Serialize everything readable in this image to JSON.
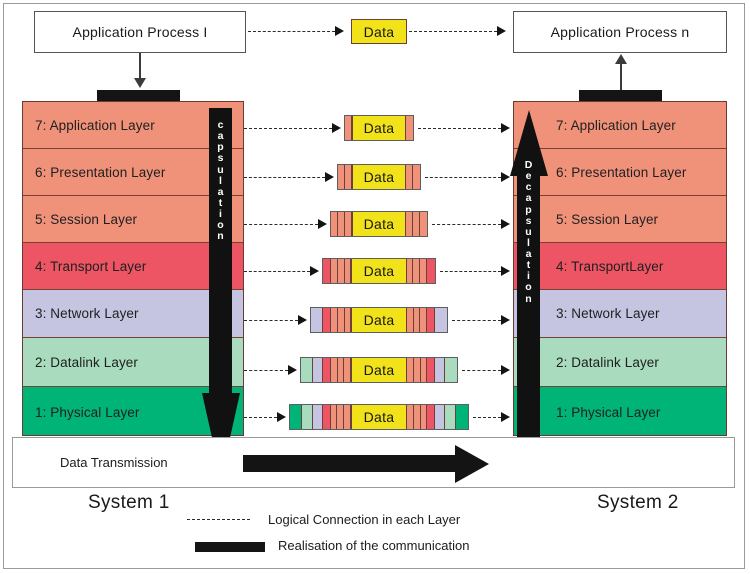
{
  "diagram": {
    "title": "OSI Layer Encapsulation and Decapsulation",
    "data_label": "Data"
  },
  "top": {
    "process_left": "Application Process I",
    "process_right": "Application Process n",
    "top_packet_label": "Data"
  },
  "systems": {
    "left_name": "System 1",
    "right_name": "System 2"
  },
  "layers_left": [
    {
      "label": "7: Application Layer",
      "color": "#f0927a"
    },
    {
      "label": "6: Presentation Layer",
      "color": "#f0927a"
    },
    {
      "label": "5: Session Layer",
      "color": "#f0927a"
    },
    {
      "label": "4: Transport  Layer",
      "color": "#ed5464"
    },
    {
      "label": "3: Network Layer",
      "color": "#c5c5e2"
    },
    {
      "label": "2: Datalink Layer",
      "color": "#a9dcbe"
    },
    {
      "label": "1: Physical Layer",
      "color": "#00b477"
    }
  ],
  "layers_right": [
    {
      "label": "7: Application Layer",
      "color": "#f0927a"
    },
    {
      "label": "6: Presentation Layer",
      "color": "#f0927a"
    },
    {
      "label": "5: Session Layer",
      "color": "#f0927a"
    },
    {
      "label": "4: TransportLayer",
      "color": "#ed5464"
    },
    {
      "label": "3: Network Layer",
      "color": "#c5c5e2"
    },
    {
      "label": "2: Datalink Layer",
      "color": "#a9dcbe"
    },
    {
      "label": "1: Physical Layer",
      "color": "#00b477"
    }
  ],
  "encapsulation": {
    "left_word": "capsulation",
    "left_letters": [
      "c",
      "a",
      "p",
      "s",
      "u",
      "l",
      "a",
      "t",
      "i",
      "o",
      "n"
    ],
    "right_word": "Decapsulation",
    "right_letters": [
      "D",
      "e",
      "c",
      "a",
      "p",
      "s",
      "u",
      "l",
      "a",
      "t",
      "i",
      "o",
      "n"
    ]
  },
  "packets": [
    {
      "layer": "7",
      "label": "Data",
      "left": [
        {
          "c": "#f0927a",
          "w": 7
        }
      ],
      "right": [
        {
          "c": "#f0927a",
          "w": 7
        }
      ]
    },
    {
      "layer": "6",
      "label": "Data",
      "left": [
        {
          "c": "#f0927a",
          "w": 7
        },
        {
          "c": "#f0927a",
          "w": 7
        }
      ],
      "right": [
        {
          "c": "#f0927a",
          "w": 7
        },
        {
          "c": "#f0927a",
          "w": 7
        }
      ]
    },
    {
      "layer": "5",
      "label": "Data",
      "left": [
        {
          "c": "#f0927a",
          "w": 7
        },
        {
          "c": "#f0927a",
          "w": 7
        },
        {
          "c": "#f0927a",
          "w": 7
        }
      ],
      "right": [
        {
          "c": "#f0927a",
          "w": 7
        },
        {
          "c": "#f0927a",
          "w": 7
        },
        {
          "c": "#f0927a",
          "w": 7
        }
      ]
    },
    {
      "layer": "4",
      "label": "Data",
      "left": [
        {
          "c": "#ed5464",
          "w": 8
        },
        {
          "c": "#f0927a",
          "w": 7
        },
        {
          "c": "#f0927a",
          "w": 7
        },
        {
          "c": "#f0927a",
          "w": 7
        }
      ],
      "right": [
        {
          "c": "#f0927a",
          "w": 7
        },
        {
          "c": "#f0927a",
          "w": 7
        },
        {
          "c": "#f0927a",
          "w": 7
        },
        {
          "c": "#ed5464",
          "w": 8
        }
      ]
    },
    {
      "layer": "3",
      "label": "Data",
      "left": [
        {
          "c": "#c5c5e2",
          "w": 12
        },
        {
          "c": "#ed5464",
          "w": 8
        },
        {
          "c": "#f0927a",
          "w": 7
        },
        {
          "c": "#f0927a",
          "w": 7
        },
        {
          "c": "#f0927a",
          "w": 7
        }
      ],
      "right": [
        {
          "c": "#f0927a",
          "w": 7
        },
        {
          "c": "#f0927a",
          "w": 7
        },
        {
          "c": "#f0927a",
          "w": 7
        },
        {
          "c": "#ed5464",
          "w": 8
        },
        {
          "c": "#c5c5e2",
          "w": 12
        }
      ]
    },
    {
      "layer": "2",
      "label": "Data",
      "left": [
        {
          "c": "#a9dcbe",
          "w": 12
        },
        {
          "c": "#c5c5e2",
          "w": 10
        },
        {
          "c": "#ed5464",
          "w": 8
        },
        {
          "c": "#f0927a",
          "w": 7
        },
        {
          "c": "#f0927a",
          "w": 7
        },
        {
          "c": "#f0927a",
          "w": 7
        }
      ],
      "right": [
        {
          "c": "#f0927a",
          "w": 7
        },
        {
          "c": "#f0927a",
          "w": 7
        },
        {
          "c": "#f0927a",
          "w": 7
        },
        {
          "c": "#ed5464",
          "w": 8
        },
        {
          "c": "#c5c5e2",
          "w": 10
        },
        {
          "c": "#a9dcbe",
          "w": 12
        }
      ]
    },
    {
      "layer": "1",
      "label": "Data",
      "left": [
        {
          "c": "#00b477",
          "w": 12
        },
        {
          "c": "#a9dcbe",
          "w": 11
        },
        {
          "c": "#c5c5e2",
          "w": 10
        },
        {
          "c": "#ed5464",
          "w": 8
        },
        {
          "c": "#f0927a",
          "w": 7
        },
        {
          "c": "#f0927a",
          "w": 7
        },
        {
          "c": "#f0927a",
          "w": 7
        }
      ],
      "right": [
        {
          "c": "#f0927a",
          "w": 7
        },
        {
          "c": "#f0927a",
          "w": 7
        },
        {
          "c": "#f0927a",
          "w": 7
        },
        {
          "c": "#ed5464",
          "w": 8
        },
        {
          "c": "#c5c5e2",
          "w": 10
        },
        {
          "c": "#a9dcbe",
          "w": 11
        },
        {
          "c": "#00b477",
          "w": 12
        }
      ]
    }
  ],
  "bottom": {
    "transmission_label": "Data Transmission"
  },
  "legend": [
    {
      "marker": "dashed-line",
      "text": "Logical Connection  in  each Layer"
    },
    {
      "marker": "solid-bar",
      "text": "Realisation  of  the  communication"
    }
  ],
  "colors": {
    "upper_layers": "#f0927a",
    "transport": "#ed5464",
    "network": "#c5c5e2",
    "datalink": "#a9dcbe",
    "physical": "#00b477",
    "data": "#f2e21a",
    "black": "#141414"
  }
}
